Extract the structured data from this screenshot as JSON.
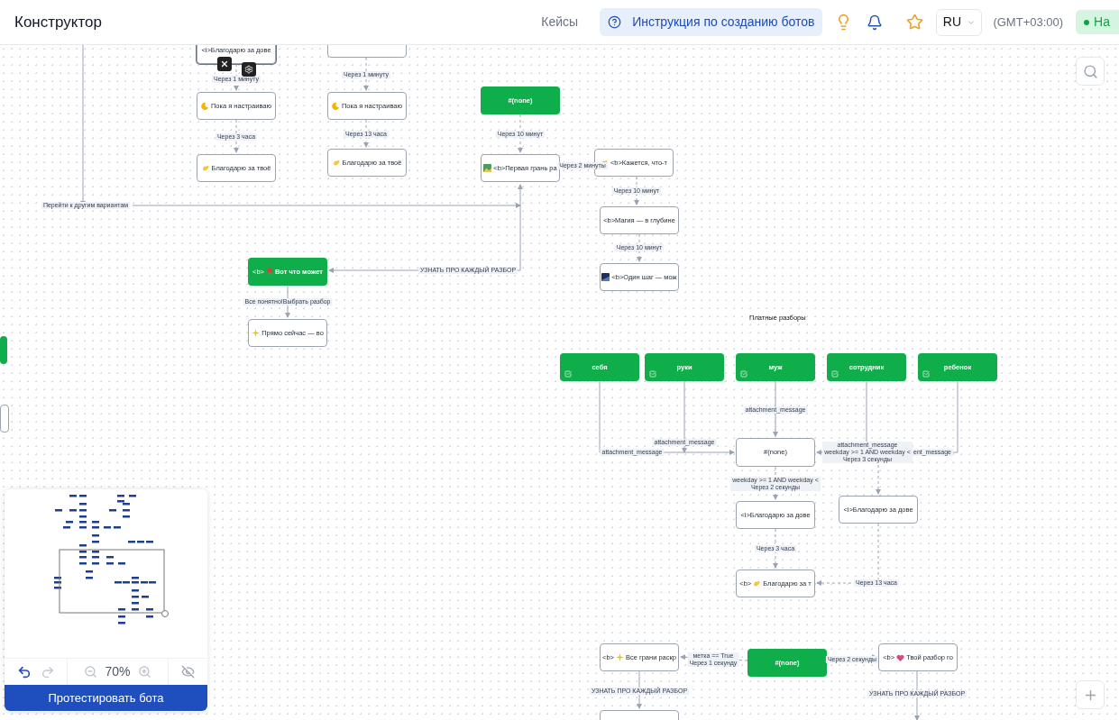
{
  "header": {
    "title": "Конструктор",
    "nav_link": "Кейсы",
    "guide_button": "Инструкция по созданию ботов",
    "language": "RU",
    "timezone": "(GMT+03:00)",
    "status_button": "На"
  },
  "canvas": {
    "nodes": [
      {
        "kind": "message",
        "text": "<i>Благодарю за дове",
        "selected": true
      },
      {
        "kind": "message",
        "selected": false
      },
      {
        "kind": "message",
        "text": "Пока я настраиваю",
        "selected": false
      },
      {
        "kind": "message",
        "text": "Пока я настраиваю",
        "selected": false
      },
      {
        "kind": "message",
        "text": "Благодарю за твоё",
        "selected": false
      },
      {
        "kind": "message",
        "text": "Благодарю за твоё",
        "selected": false
      },
      {
        "kind": "start",
        "text": "#(none)",
        "selected": false
      },
      {
        "kind": "message",
        "text": "<b>Первая грань ра",
        "selected": false
      },
      {
        "kind": "message",
        "text": "<b>Кажется, что-т",
        "selected": false
      },
      {
        "kind": "message",
        "text": "<b>Магия — в глубине",
        "selected": false
      },
      {
        "kind": "message",
        "text": "<b>Один шаг — мож",
        "selected": false
      },
      {
        "kind": "start",
        "prefix": "<b>",
        "text": "Вот что может",
        "selected": false
      },
      {
        "kind": "message",
        "text": "Прямо сейчас — во",
        "selected": false
      },
      {
        "kind": "choice",
        "text": "себя",
        "selected": false
      },
      {
        "kind": "choice",
        "text": "руки",
        "selected": false
      },
      {
        "kind": "choice",
        "text": "муж",
        "selected": false
      },
      {
        "kind": "choice",
        "text": "сотрудник",
        "selected": false
      },
      {
        "kind": "choice",
        "text": "ребенок",
        "selected": false
      },
      {
        "kind": "message",
        "text": "#(none)",
        "selected": false
      },
      {
        "kind": "message",
        "text": "<i>Благодарю за дове",
        "selected": false
      },
      {
        "kind": "message",
        "text": "<i>Благодарю за дове",
        "selected": false
      },
      {
        "kind": "message",
        "prefix": "<b>",
        "text": "Благодарю за т",
        "selected": false
      },
      {
        "kind": "message",
        "prefix": "<b>",
        "text": "Все грани раскр",
        "selected": false
      },
      {
        "kind": "start",
        "text": "#(none)",
        "selected": false
      },
      {
        "kind": "message",
        "prefix": "<b>",
        "text": "Твой разбор го",
        "selected": false
      },
      {
        "kind": "message",
        "selected": false
      },
      {
        "kind": "start",
        "selected": false
      },
      {
        "kind": "message",
        "selected": false
      }
    ],
    "edge_labels": [
      "Через 1 минуту",
      "Через 1 минуту",
      "Через 3 часа",
      "Через 13 часа",
      "Через 10 минут",
      "Через 2 минуты",
      "Через 10 минут",
      "Через 10 минут",
      "Перейти к другим вариантам",
      "УЗНАТЬ ПРО КАЖДЫЙ РАЗБОР",
      "Все понятно!Выбрать разбор",
      "attachment_message",
      "attachment_message",
      "attachment_message",
      "attachment_message\nweekday >= 1 AND weekday <\nЧерез 3 секунды",
      "ent_message",
      "weekday >= 1 AND weekday <\nЧерез 2 секунды",
      "Через 3 часа",
      "Через 13 часа",
      "метка == True\nЧерез 1 секунду",
      "Через 2 секунды",
      "УЗНАТЬ ПРО КАЖДЫЙ РАЗБОР",
      "УЗНАТЬ ПРО КАЖДЫЙ РАЗБОР"
    ],
    "group_label": "Платные разборы"
  },
  "minimap": {
    "undo": {
      "disabled": false
    },
    "redo": {
      "disabled": true
    },
    "zoom": "70%"
  },
  "test_button": "Протестировать бота"
}
